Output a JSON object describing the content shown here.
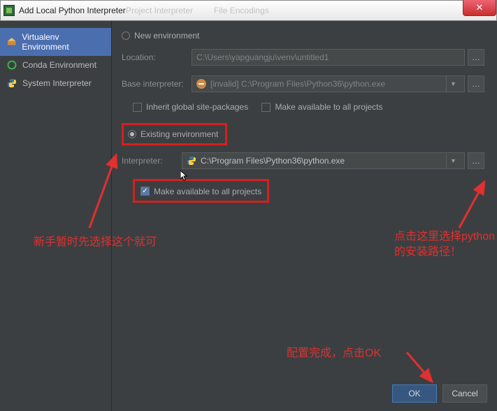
{
  "title": "Add Local Python Interpreter",
  "ghost_tabs": [
    "Project Interpreter",
    "File Encodings"
  ],
  "close_glyph": "✕",
  "sidebar": {
    "items": [
      {
        "label": "Virtualenv Environment"
      },
      {
        "label": "Conda Environment"
      },
      {
        "label": "System Interpreter"
      }
    ]
  },
  "colors": {
    "accent": "#4b6eaf",
    "highlight": "#d4201f"
  },
  "form": {
    "new_env_label": "New environment",
    "location_label": "Location:",
    "location_value": "C:\\Users\\yapguangju\\venv\\untitled1",
    "base_label": "Base interpreter:",
    "base_value": "[invalid] C:\\Program Files\\Python36\\python.exe",
    "inherit_label": "Inherit global site-packages",
    "make_avail_new": "Make available to all projects",
    "existing_label": "Existing environment",
    "interpreter_label": "Interpreter:",
    "interpreter_value": "C:\\Program Files\\Python36\\python.exe",
    "make_avail_exist": "Make available to all projects",
    "check_glyph": "✓",
    "dd_glyph": "▼",
    "dots": "…"
  },
  "annotations": {
    "left": "新手暂时先选择这个就可",
    "right": "点击这里选择python的安装路径！",
    "bottom": "配置完成，点击OK"
  },
  "footer": {
    "ok": "OK",
    "cancel": "Cancel"
  }
}
